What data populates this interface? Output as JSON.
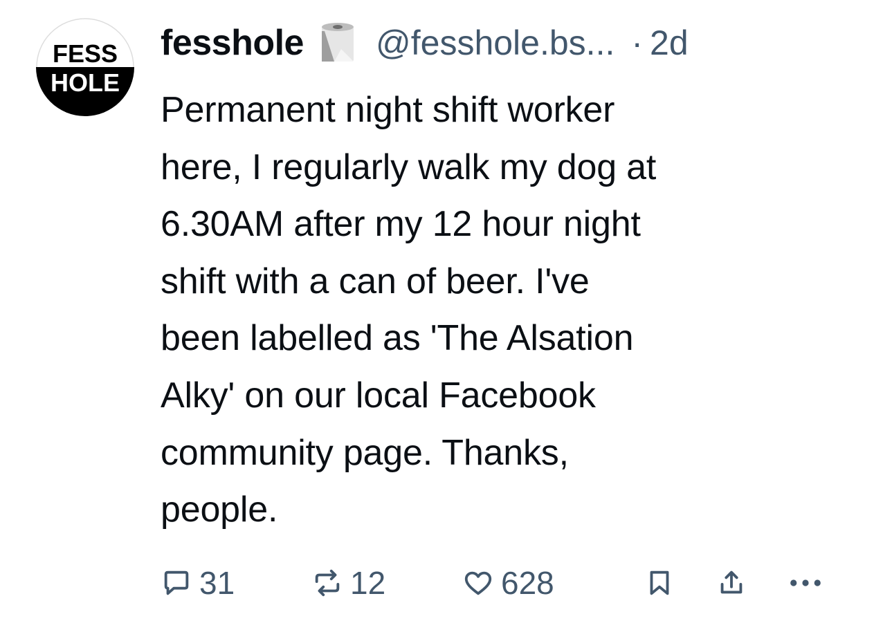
{
  "author": {
    "avatar_text_top": "FESS",
    "avatar_text_bottom": "HOLE",
    "display_name": "fesshole",
    "badge_icon": "toilet-paper-icon",
    "handle": "@fesshole.bs...",
    "separator": "·",
    "timestamp": "2d"
  },
  "post": {
    "lines": [
      "Permanent night shift worker",
      "here, I regularly walk my dog at",
      "6.30AM after my 12 hour night",
      "shift with a can of beer. I've",
      "been labelled as 'The Alsation",
      "Alky' on our local Facebook",
      "community page. Thanks,",
      "people."
    ]
  },
  "actions": {
    "replies": "31",
    "reposts": "12",
    "likes": "628",
    "icons": [
      "reply-icon",
      "repost-icon",
      "like-icon",
      "bookmark-icon",
      "share-icon",
      "more-icon"
    ]
  },
  "colors": {
    "text": "#0b0f14",
    "muted": "#42576c"
  }
}
